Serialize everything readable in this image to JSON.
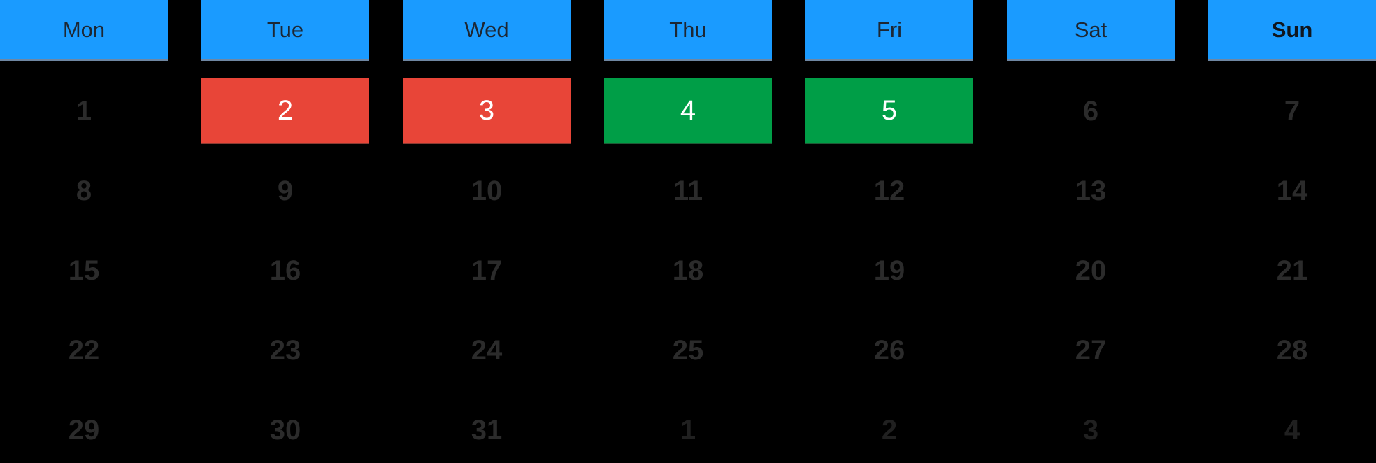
{
  "colors": {
    "header_background": "#1a9bff",
    "range_start_red": "#e84538",
    "range_end_green": "#009e47",
    "page_background": "#000000"
  },
  "weekdays": [
    {
      "label": "Mon",
      "bold": false
    },
    {
      "label": "Tue",
      "bold": false
    },
    {
      "label": "Wed",
      "bold": false
    },
    {
      "label": "Thu",
      "bold": false
    },
    {
      "label": "Fri",
      "bold": false
    },
    {
      "label": "Sat",
      "bold": false
    },
    {
      "label": "Sun",
      "bold": true
    }
  ],
  "weeks": [
    [
      {
        "day": "1",
        "state": "normal"
      },
      {
        "day": "2",
        "state": "red"
      },
      {
        "day": "3",
        "state": "red"
      },
      {
        "day": "4",
        "state": "green"
      },
      {
        "day": "5",
        "state": "green"
      },
      {
        "day": "6",
        "state": "normal"
      },
      {
        "day": "7",
        "state": "normal"
      }
    ],
    [
      {
        "day": "8",
        "state": "normal"
      },
      {
        "day": "9",
        "state": "normal"
      },
      {
        "day": "10",
        "state": "normal"
      },
      {
        "day": "11",
        "state": "normal"
      },
      {
        "day": "12",
        "state": "normal"
      },
      {
        "day": "13",
        "state": "normal"
      },
      {
        "day": "14",
        "state": "normal"
      }
    ],
    [
      {
        "day": "15",
        "state": "normal"
      },
      {
        "day": "16",
        "state": "normal"
      },
      {
        "day": "17",
        "state": "normal"
      },
      {
        "day": "18",
        "state": "normal"
      },
      {
        "day": "19",
        "state": "normal"
      },
      {
        "day": "20",
        "state": "normal"
      },
      {
        "day": "21",
        "state": "normal"
      }
    ],
    [
      {
        "day": "22",
        "state": "normal"
      },
      {
        "day": "23",
        "state": "normal"
      },
      {
        "day": "24",
        "state": "normal"
      },
      {
        "day": "25",
        "state": "normal"
      },
      {
        "day": "26",
        "state": "normal"
      },
      {
        "day": "27",
        "state": "normal"
      },
      {
        "day": "28",
        "state": "normal"
      }
    ],
    [
      {
        "day": "29",
        "state": "normal"
      },
      {
        "day": "30",
        "state": "normal"
      },
      {
        "day": "31",
        "state": "normal"
      },
      {
        "day": "1",
        "state": "dim"
      },
      {
        "day": "2",
        "state": "dim"
      },
      {
        "day": "3",
        "state": "dim"
      },
      {
        "day": "4",
        "state": "dim"
      }
    ]
  ]
}
